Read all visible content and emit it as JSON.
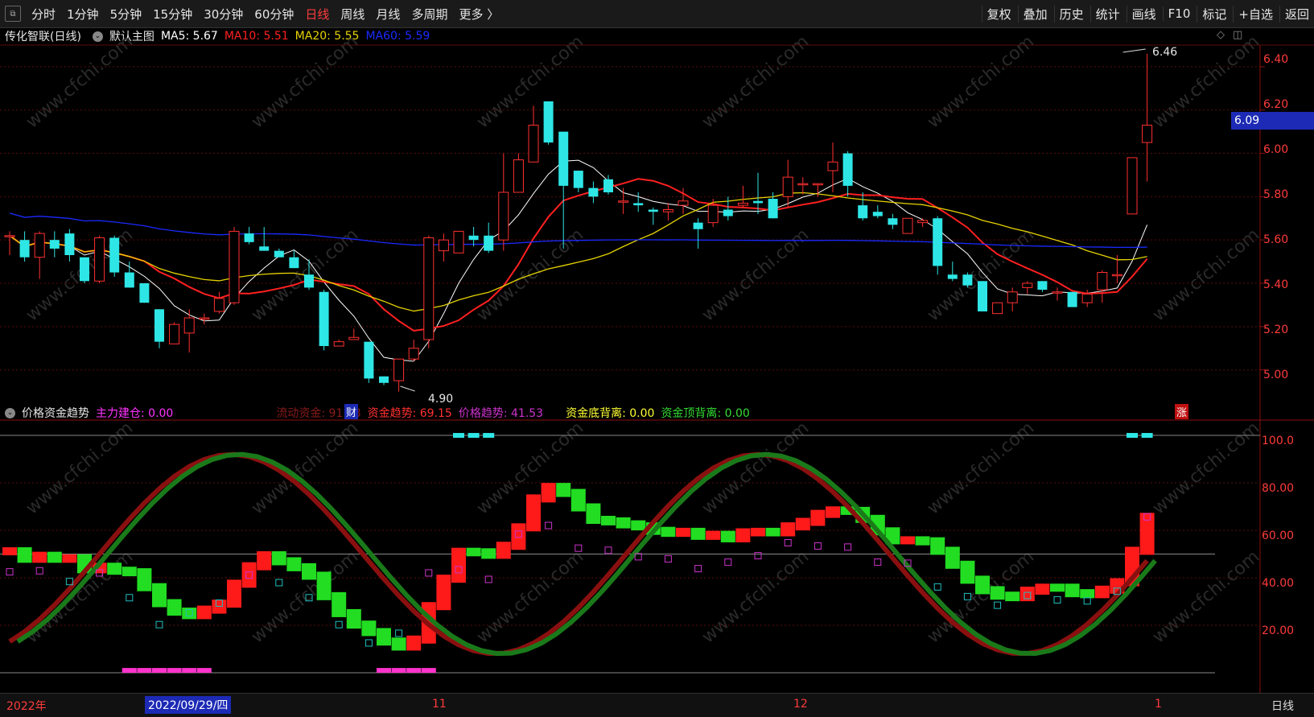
{
  "toolbar": {
    "periods": [
      "分时",
      "1分钟",
      "5分钟",
      "15分钟",
      "30分钟",
      "60分钟",
      "日线",
      "周线",
      "月线",
      "多周期",
      "更多 〉"
    ],
    "active_period": "日线",
    "right_buttons": [
      "复权",
      "叠加",
      "历史",
      "统计",
      "画线",
      "F10",
      "标记",
      "+自选",
      "返回"
    ]
  },
  "main_chart": {
    "stock_name": "传化智联(日线)",
    "template": "默认主图",
    "ma": [
      {
        "label": "MA5: 5.67",
        "color": "#ffffff"
      },
      {
        "label": "MA10: 5.51",
        "color": "#ff2020"
      },
      {
        "label": "MA20: 5.55",
        "color": "#e6d300"
      },
      {
        "label": "MA60: 5.59",
        "color": "#1a2aff"
      }
    ],
    "y_ticks": [
      "6.40",
      "6.20",
      "6.00",
      "5.80",
      "5.60",
      "5.40",
      "5.20",
      "5.00"
    ],
    "current_price": "6.09",
    "high_label": "6.46",
    "low_label": "4.90",
    "marker_cai": "财",
    "marker_zhang": "涨",
    "watermark": "www.cfchi.com"
  },
  "indicator": {
    "name": "价格资金趋势",
    "params": [
      {
        "label": "主力建仓: 0.00",
        "color": "#ff33ff"
      },
      {
        "label": "流动资金: 91.18",
        "color": "#8a1a1a"
      },
      {
        "label": "资金趋势: 69.15",
        "color": "#ff3030"
      },
      {
        "label": "价格趋势: 41.53",
        "color": "#cc33cc"
      },
      {
        "label": "资金底背离: 0.00",
        "color": "#ffff33"
      },
      {
        "label": "资金顶背离: 0.00",
        "color": "#33dd33"
      }
    ],
    "y_ticks": [
      "100.0",
      "80.00",
      "60.00",
      "40.00",
      "20.00"
    ]
  },
  "timeline": {
    "year_label": "2022年",
    "selected_date": "2022/09/29/四",
    "month_11": "11",
    "month_12": "12",
    "month_1": "1",
    "period_label": "日线"
  },
  "chart_data": {
    "type": "candlestick",
    "title": "传化智联(日线)",
    "ylim": [
      4.85,
      6.5
    ],
    "candles": [
      {
        "o": 5.62,
        "h": 5.64,
        "l": 5.53,
        "c": 5.62
      },
      {
        "o": 5.6,
        "h": 5.64,
        "l": 5.5,
        "c": 5.52
      },
      {
        "o": 5.52,
        "h": 5.64,
        "l": 5.42,
        "c": 5.63
      },
      {
        "o": 5.6,
        "h": 5.64,
        "l": 5.52,
        "c": 5.56
      },
      {
        "o": 5.63,
        "h": 5.65,
        "l": 5.5,
        "c": 5.53
      },
      {
        "o": 5.52,
        "h": 5.52,
        "l": 5.4,
        "c": 5.41
      },
      {
        "o": 5.41,
        "h": 5.62,
        "l": 5.4,
        "c": 5.61
      },
      {
        "o": 5.61,
        "h": 5.62,
        "l": 5.43,
        "c": 5.45
      },
      {
        "o": 5.45,
        "h": 5.5,
        "l": 5.38,
        "c": 5.38
      },
      {
        "o": 5.4,
        "h": 5.4,
        "l": 5.31,
        "c": 5.31
      },
      {
        "o": 5.28,
        "h": 5.28,
        "l": 5.1,
        "c": 5.13
      },
      {
        "o": 5.12,
        "h": 5.22,
        "l": 5.12,
        "c": 5.21
      },
      {
        "o": 5.17,
        "h": 5.28,
        "l": 5.08,
        "c": 5.24
      },
      {
        "o": 5.24,
        "h": 5.26,
        "l": 5.21,
        "c": 5.24
      },
      {
        "o": 5.27,
        "h": 5.36,
        "l": 5.26,
        "c": 5.33
      },
      {
        "o": 5.31,
        "h": 5.66,
        "l": 5.3,
        "c": 5.64
      },
      {
        "o": 5.63,
        "h": 5.66,
        "l": 5.58,
        "c": 5.59
      },
      {
        "o": 5.57,
        "h": 5.66,
        "l": 5.55,
        "c": 5.55
      },
      {
        "o": 5.55,
        "h": 5.56,
        "l": 5.52,
        "c": 5.52
      },
      {
        "o": 5.52,
        "h": 5.55,
        "l": 5.47,
        "c": 5.47
      },
      {
        "o": 5.44,
        "h": 5.51,
        "l": 5.37,
        "c": 5.38
      },
      {
        "o": 5.36,
        "h": 5.37,
        "l": 5.09,
        "c": 5.11
      },
      {
        "o": 5.11,
        "h": 5.14,
        "l": 5.11,
        "c": 5.13
      },
      {
        "o": 5.14,
        "h": 5.19,
        "l": 5.14,
        "c": 5.15
      },
      {
        "o": 5.13,
        "h": 5.13,
        "l": 4.94,
        "c": 4.96
      },
      {
        "o": 4.97,
        "h": 4.97,
        "l": 4.93,
        "c": 4.94
      },
      {
        "o": 4.95,
        "h": 5.05,
        "l": 4.9,
        "c": 5.05
      },
      {
        "o": 5.05,
        "h": 5.14,
        "l": 5.04,
        "c": 5.1
      },
      {
        "o": 5.14,
        "h": 5.62,
        "l": 5.1,
        "c": 5.61
      },
      {
        "o": 5.55,
        "h": 5.63,
        "l": 5.5,
        "c": 5.6
      },
      {
        "o": 5.54,
        "h": 5.64,
        "l": 5.55,
        "c": 5.64
      },
      {
        "o": 5.62,
        "h": 5.66,
        "l": 5.57,
        "c": 5.6
      },
      {
        "o": 5.62,
        "h": 5.68,
        "l": 5.54,
        "c": 5.55
      },
      {
        "o": 5.6,
        "h": 6.0,
        "l": 5.55,
        "c": 5.82
      },
      {
        "o": 5.82,
        "h": 6.0,
        "l": 5.82,
        "c": 5.97
      },
      {
        "o": 5.96,
        "h": 6.22,
        "l": 5.96,
        "c": 6.13
      },
      {
        "o": 6.24,
        "h": 6.24,
        "l": 6.04,
        "c": 6.05
      },
      {
        "o": 6.1,
        "h": 6.1,
        "l": 5.56,
        "c": 5.85
      },
      {
        "o": 5.92,
        "h": 5.92,
        "l": 5.82,
        "c": 5.84
      },
      {
        "o": 5.84,
        "h": 5.87,
        "l": 5.77,
        "c": 5.8
      },
      {
        "o": 5.88,
        "h": 5.9,
        "l": 5.81,
        "c": 5.82
      },
      {
        "o": 5.78,
        "h": 5.84,
        "l": 5.72,
        "c": 5.78
      },
      {
        "o": 5.77,
        "h": 5.82,
        "l": 5.73,
        "c": 5.76
      },
      {
        "o": 5.74,
        "h": 5.75,
        "l": 5.67,
        "c": 5.73
      },
      {
        "o": 5.73,
        "h": 5.77,
        "l": 5.69,
        "c": 5.74
      },
      {
        "o": 5.76,
        "h": 5.84,
        "l": 5.72,
        "c": 5.78
      },
      {
        "o": 5.68,
        "h": 5.7,
        "l": 5.56,
        "c": 5.65
      },
      {
        "o": 5.68,
        "h": 5.79,
        "l": 5.66,
        "c": 5.76
      },
      {
        "o": 5.74,
        "h": 5.8,
        "l": 5.69,
        "c": 5.71
      },
      {
        "o": 5.76,
        "h": 5.85,
        "l": 5.75,
        "c": 5.77
      },
      {
        "o": 5.78,
        "h": 5.91,
        "l": 5.72,
        "c": 5.77
      },
      {
        "o": 5.79,
        "h": 5.82,
        "l": 5.7,
        "c": 5.7
      },
      {
        "o": 5.8,
        "h": 5.97,
        "l": 5.75,
        "c": 5.89
      },
      {
        "o": 5.86,
        "h": 5.89,
        "l": 5.81,
        "c": 5.86
      },
      {
        "o": 5.86,
        "h": 5.86,
        "l": 5.8,
        "c": 5.86
      },
      {
        "o": 5.92,
        "h": 6.05,
        "l": 5.82,
        "c": 5.96
      },
      {
        "o": 6.0,
        "h": 6.01,
        "l": 5.8,
        "c": 5.85
      },
      {
        "o": 5.76,
        "h": 5.82,
        "l": 5.69,
        "c": 5.7
      },
      {
        "o": 5.73,
        "h": 5.76,
        "l": 5.7,
        "c": 5.71
      },
      {
        "o": 5.7,
        "h": 5.72,
        "l": 5.65,
        "c": 5.67
      },
      {
        "o": 5.63,
        "h": 5.7,
        "l": 5.63,
        "c": 5.7
      },
      {
        "o": 5.68,
        "h": 5.7,
        "l": 5.66,
        "c": 5.69
      },
      {
        "o": 5.7,
        "h": 5.71,
        "l": 5.44,
        "c": 5.48
      },
      {
        "o": 5.44,
        "h": 5.5,
        "l": 5.41,
        "c": 5.42
      },
      {
        "o": 5.44,
        "h": 5.45,
        "l": 5.38,
        "c": 5.39
      },
      {
        "o": 5.41,
        "h": 5.41,
        "l": 5.27,
        "c": 5.27
      },
      {
        "o": 5.26,
        "h": 5.31,
        "l": 5.27,
        "c": 5.31
      },
      {
        "o": 5.31,
        "h": 5.38,
        "l": 5.27,
        "c": 5.36
      },
      {
        "o": 5.38,
        "h": 5.41,
        "l": 5.35,
        "c": 5.4
      },
      {
        "o": 5.41,
        "h": 5.41,
        "l": 5.36,
        "c": 5.37
      },
      {
        "o": 5.36,
        "h": 5.38,
        "l": 5.32,
        "c": 5.36
      },
      {
        "o": 5.36,
        "h": 5.36,
        "l": 5.29,
        "c": 5.29
      },
      {
        "o": 5.31,
        "h": 5.37,
        "l": 5.29,
        "c": 5.35
      },
      {
        "o": 5.37,
        "h": 5.46,
        "l": 5.31,
        "c": 5.45
      },
      {
        "o": 5.44,
        "h": 5.53,
        "l": 5.4,
        "c": 5.44
      },
      {
        "o": 5.72,
        "h": 5.98,
        "l": 5.72,
        "c": 5.98
      },
      {
        "o": 6.05,
        "h": 6.46,
        "l": 5.87,
        "c": 6.13
      }
    ]
  }
}
